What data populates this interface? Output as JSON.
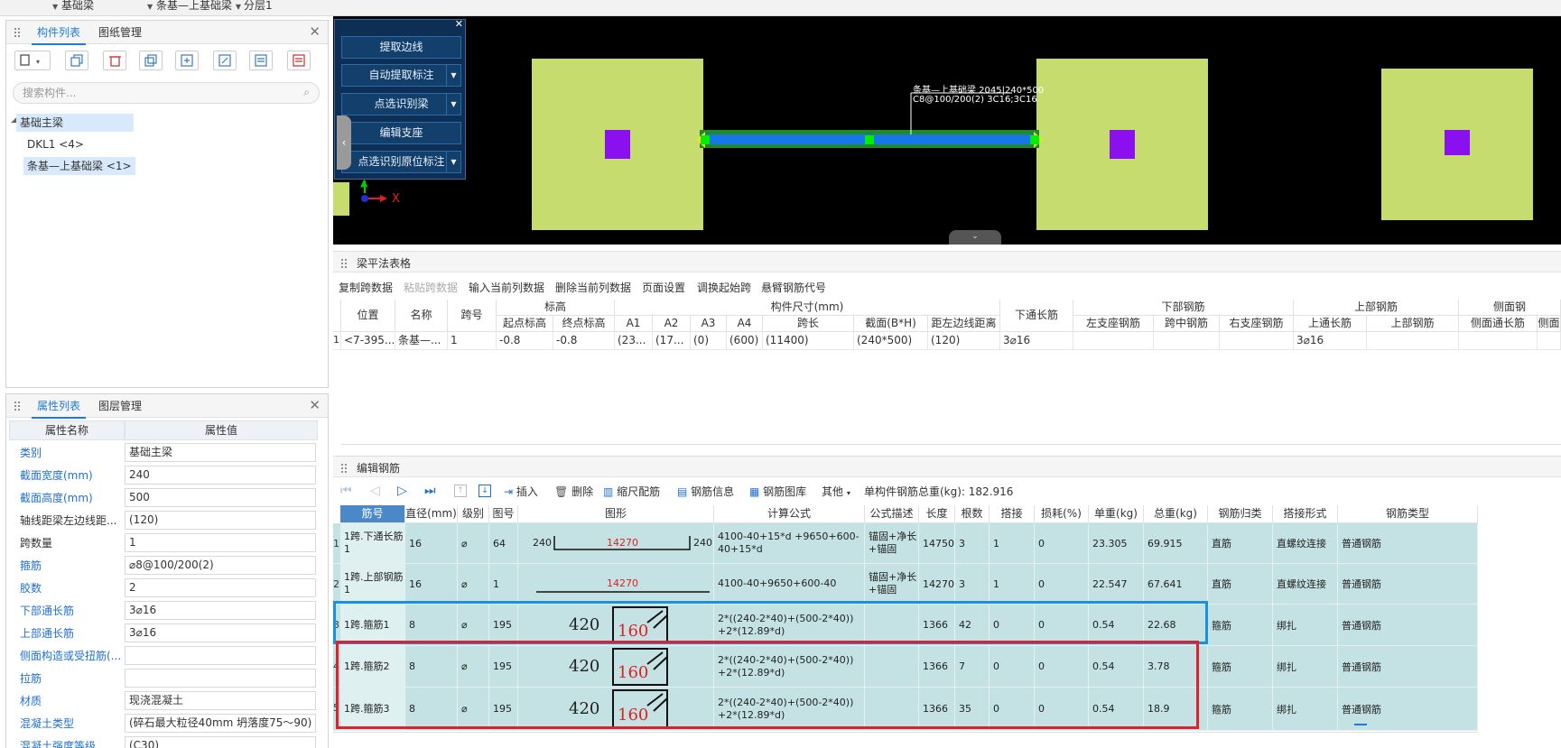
{
  "topbar": {
    "dd1": "基础梁",
    "dd2": "条基—上基础梁",
    "dd3": "分层1"
  },
  "component_pane": {
    "tabs": [
      "构件列表",
      "图纸管理"
    ],
    "search_placeholder": "搜索构件...",
    "tree": {
      "root": "基础主梁",
      "items": [
        "DKL1 <4>",
        "条基—上基础梁 <1>"
      ]
    }
  },
  "property_pane": {
    "tabs": [
      "属性列表",
      "图层管理"
    ],
    "header": [
      "属性名称",
      "属性值"
    ],
    "rows": [
      {
        "name": "类别",
        "value": "基础主梁",
        "blue": true
      },
      {
        "name": "截面宽度(mm)",
        "value": "240",
        "blue": true
      },
      {
        "name": "截面高度(mm)",
        "value": "500",
        "blue": true
      },
      {
        "name": "轴线距梁左边线距...",
        "value": "(120)",
        "blue": false
      },
      {
        "name": "跨数量",
        "value": "1",
        "blue": false
      },
      {
        "name": "箍筋",
        "value": "⌀8@100/200(2)",
        "blue": true
      },
      {
        "name": "胶数",
        "value": "2",
        "blue": true
      },
      {
        "name": "下部通长筋",
        "value": "3⌀16",
        "blue": true
      },
      {
        "name": "上部通长筋",
        "value": "3⌀16",
        "blue": true
      },
      {
        "name": "侧面构造或受扭筋(...",
        "value": "",
        "blue": true
      },
      {
        "name": "拉筋",
        "value": "",
        "blue": true
      },
      {
        "name": "材质",
        "value": "现浇混凝土",
        "blue": true
      },
      {
        "name": "混凝土类型",
        "value": "(碎石最大粒径40mm 坍落度75～90)",
        "blue": true
      },
      {
        "name": "混凝土强度等级",
        "value": "(C30)",
        "blue": true
      }
    ]
  },
  "cad": {
    "menu": [
      "提取边线",
      "自动提取标注",
      "点选识别梁",
      "编辑支座",
      "点选识别原位标注"
    ],
    "annotation_line1": "条基—上基础梁 2045|240*500",
    "annotation_line2": "C8@100/200(2) 3C16;3C16",
    "axis_x": "X"
  },
  "span_table": {
    "title": "梁平法表格",
    "toolbar": [
      "复制跨数据",
      "粘贴跨数据",
      "输入当前列数据",
      "删除当前列数据",
      "页面设置",
      "调换起始跨",
      "悬臂钢筋代号"
    ],
    "group_headers": [
      "标高",
      "构件尺寸(mm)",
      "下部钢筋",
      "上部钢筋",
      "侧面钢"
    ],
    "headers": [
      "位置",
      "名称",
      "跨号",
      "起点标高",
      "终点标高",
      "A1",
      "A2",
      "A3",
      "A4",
      "跨长",
      "截面(B*H)",
      "距左边线距离",
      "下通长筋",
      "左支座钢筋",
      "跨中钢筋",
      "右支座钢筋",
      "上通长筋",
      "上部钢筋",
      "侧面通长筋",
      "侧面"
    ],
    "row": {
      "index": "1",
      "cells": [
        "<7-395...",
        "条基—...",
        "1",
        "-0.8",
        "-0.8",
        "(23...",
        "(17...",
        "(0)",
        "(600)",
        "(11400)",
        "(240*500)",
        "(120)",
        "3⌀16",
        "",
        "",
        "",
        "3⌀16",
        "",
        "",
        ""
      ]
    }
  },
  "rebar": {
    "title": "编辑钢筋",
    "toolbar": {
      "insert": "插入",
      "delete": "删除",
      "scale": "缩尺配筋",
      "info": "钢筋信息",
      "library": "钢筋图库",
      "other": "其他",
      "total": "单构件钢筋总重(kg): 182.916"
    },
    "headers": [
      "筋号",
      "直径(mm)",
      "级别",
      "图号",
      "图形",
      "计算公式",
      "公式描述",
      "长度",
      "根数",
      "搭接",
      "损耗(%)",
      "单重(kg)",
      "总重(kg)",
      "钢筋归类",
      "搭接形式",
      "钢筋类型"
    ],
    "rows": [
      {
        "no": "1跨.下通长筋1",
        "dia": "16",
        "grade": "⌀",
        "fig": "64",
        "shape": {
          "left": "240",
          "mid": "14270",
          "right": "240"
        },
        "formula": "4100-40+15*d +9650+600-40+15*d",
        "desc": "锚固+净长+锚固",
        "len": "14750",
        "count": "3",
        "lap": "1",
        "loss": "0",
        "unit_w": "23.305",
        "total_w": "69.915",
        "cls": "直筋",
        "lap_type": "直螺纹连接",
        "type": "普通钢筋"
      },
      {
        "no": "1跨.上部钢筋1",
        "dia": "16",
        "grade": "⌀",
        "fig": "1",
        "shape": {
          "mid": "14270"
        },
        "formula": "4100-40+9650+600-40",
        "desc": "锚固+净长+锚固",
        "len": "14270",
        "count": "3",
        "lap": "1",
        "loss": "0",
        "unit_w": "22.547",
        "total_w": "67.641",
        "cls": "直筋",
        "lap_type": "直螺纹连接",
        "type": "普通钢筋"
      },
      {
        "no": "1跨.箍筋1",
        "dia": "8",
        "grade": "⌀",
        "fig": "195",
        "shape": {
          "a": "420",
          "b": "160"
        },
        "formula": "2*((240-2*40)+(500-2*40)) +2*(12.89*d)",
        "desc": "",
        "len": "1366",
        "count": "42",
        "lap": "0",
        "loss": "0",
        "unit_w": "0.54",
        "total_w": "22.68",
        "cls": "箍筋",
        "lap_type": "绑扎",
        "type": "普通钢筋"
      },
      {
        "no": "1跨.箍筋2",
        "dia": "8",
        "grade": "⌀",
        "fig": "195",
        "shape": {
          "a": "420",
          "b": "160"
        },
        "formula": "2*((240-2*40)+(500-2*40)) +2*(12.89*d)",
        "desc": "",
        "len": "1366",
        "count": "7",
        "lap": "0",
        "loss": "0",
        "unit_w": "0.54",
        "total_w": "3.78",
        "cls": "箍筋",
        "lap_type": "绑扎",
        "type": "普通钢筋"
      },
      {
        "no": "1跨.箍筋3",
        "dia": "8",
        "grade": "⌀",
        "fig": "195",
        "shape": {
          "a": "420",
          "b": "160"
        },
        "formula": "2*((240-2*40)+(500-2*40)) +2*(12.89*d)",
        "desc": "",
        "len": "1366",
        "count": "35",
        "lap": "0",
        "loss": "0",
        "unit_w": "0.54",
        "total_w": "18.9",
        "cls": "箍筋",
        "lap_type": "绑扎",
        "type": "普通钢筋"
      }
    ],
    "row_numbers": [
      "1",
      "2",
      "3",
      "4",
      "5",
      "6"
    ]
  },
  "colors": {
    "accent": "#1f7bd8",
    "row_bg": "#c4e2e3",
    "highlight_blue": "#1a90e0",
    "highlight_red": "#e0202a",
    "pad": "#c6dc6e",
    "column": "#8a10f0"
  }
}
